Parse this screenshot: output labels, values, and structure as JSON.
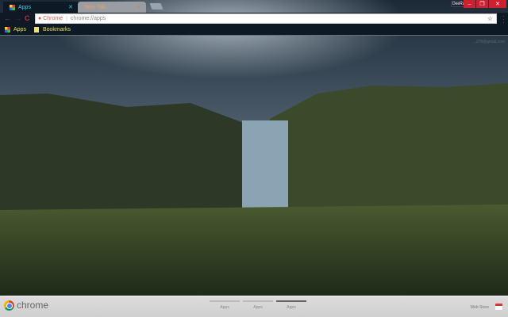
{
  "tabs": [
    {
      "label": "Apps",
      "active": true
    },
    {
      "label": "New Tab",
      "active": false
    }
  ],
  "window": {
    "profile": "DeeRay",
    "minimize": "–",
    "restore": "❐",
    "close": "✕"
  },
  "toolbar": {
    "back": "←",
    "forward": "→",
    "reload": "C",
    "chip": "Chrome",
    "url": "chrome://apps",
    "star": "☆"
  },
  "bookmarks": [
    {
      "label": "Apps"
    },
    {
      "label": "Bookmarks"
    }
  ],
  "account_email": "...378@gmail.com",
  "footer": {
    "brand": "chrome",
    "pages": [
      {
        "label": "Apps",
        "selected": false
      },
      {
        "label": "Apps",
        "selected": false
      },
      {
        "label": "Apps",
        "selected": true
      }
    ],
    "web_store": "Web Store"
  }
}
